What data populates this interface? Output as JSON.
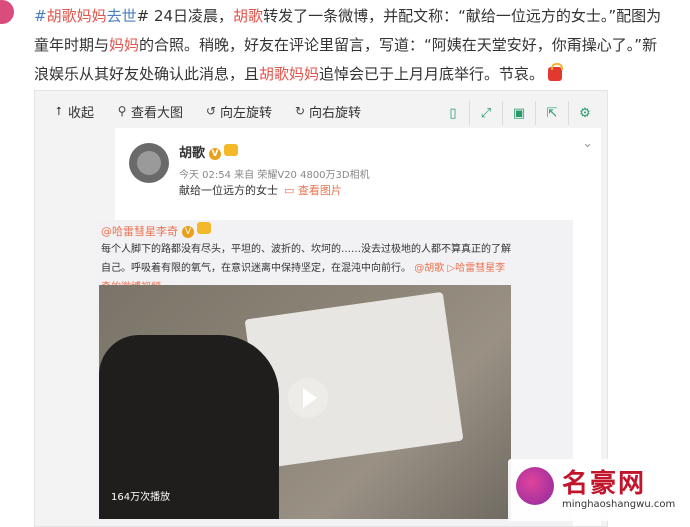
{
  "article": {
    "line1_prefix": "#",
    "tag_hl": "胡歌妈妈",
    "tag_rest": "去世",
    "line1_after_tag": "# 24日凌晨，",
    "name1": "胡歌",
    "line1_rest": "转发了一条微博，并配文称：“献给一位远方的女士。”配图为",
    "line2_a": "童年时期与",
    "mom": "妈妈",
    "line2_b": "的合照。稍晚，好友在评论里留言，写道：“阿姨在天堂安好，你甭操心了。”新",
    "line3_a": "浪娱乐从其好友处确认此消息，且",
    "mom2": "胡歌妈妈",
    "line3_b": "追悼会已于上月月底举行。节哀。"
  },
  "toolbar": {
    "collapse": "收起",
    "view_large": "查看大图",
    "rotate_left": "向左旋转",
    "rotate_right": "向右旋转"
  },
  "post": {
    "name": "胡歌",
    "meta": "今天 02:54 来自 荣耀V20 4800万3D相机",
    "text": "献给一位远方的女士",
    "view_image": "查看图片"
  },
  "repost": {
    "name": "@哈雷彗星李奇",
    "body_a": "每个人脚下的路都没有尽头，平坦的、波折的、坎坷的……没去过极地的人都不算真正的了解自己。呼吸着有限的氧气，在意识迷离中保持坚定，在混沌中向前行。",
    "at": "@胡歌",
    "link": "哈雷彗星李奇的微博视频"
  },
  "video": {
    "views": "164万次播放"
  },
  "watermark": {
    "title": "名豪网",
    "url": "minghaoshangwu.com"
  },
  "icons": {
    "collapse": "arrow-up-icon",
    "search": "search-icon",
    "rotate_left": "rotate-left-icon",
    "rotate_right": "rotate-right-icon"
  }
}
